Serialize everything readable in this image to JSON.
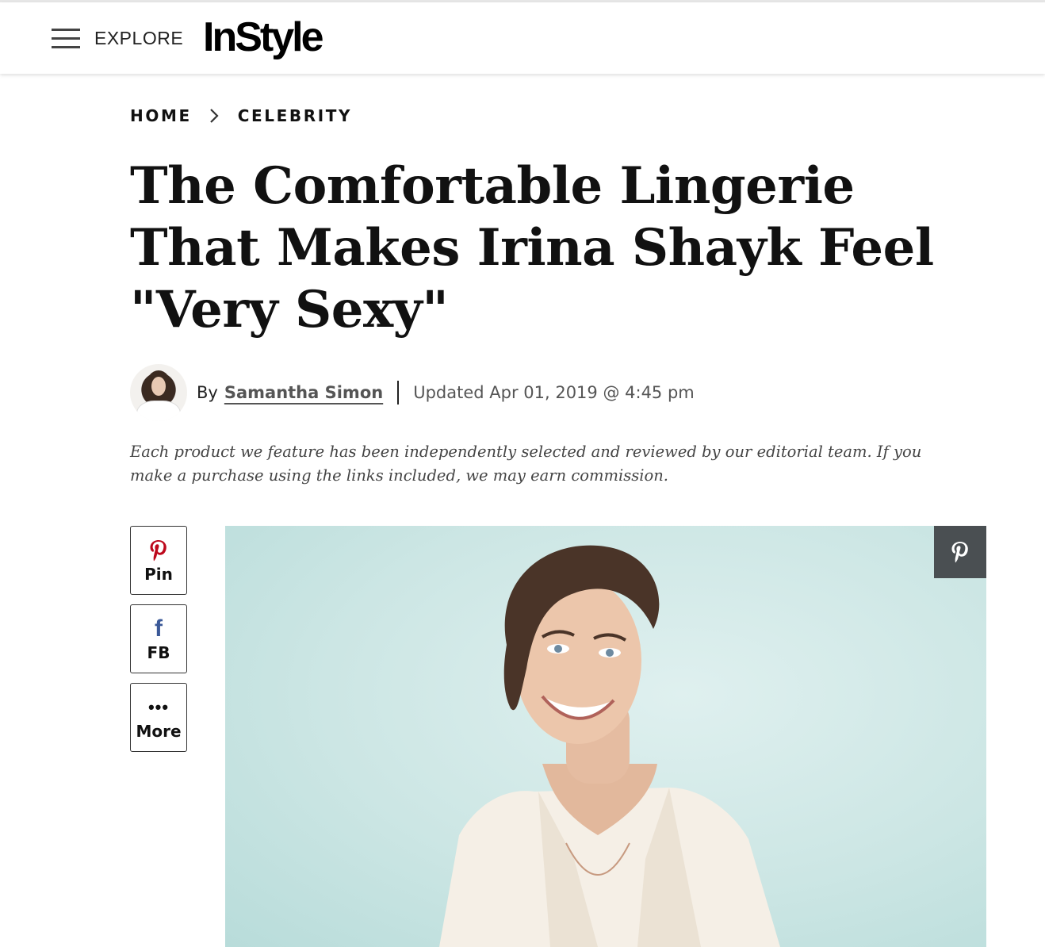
{
  "header": {
    "explore_label": "EXPLORE",
    "logo_text": "InStyle"
  },
  "breadcrumb": {
    "items": [
      "HOME",
      "CELEBRITY"
    ]
  },
  "article": {
    "headline": "The Comfortable Lingerie That Makes Irina Shayk Feel \"Very Sexy\"",
    "by_prefix": "By",
    "author": "Samantha Simon",
    "updated": "Updated Apr 01, 2019 @ 4:45 pm",
    "disclaimer": "Each product we feature has been independently selected and reviewed by our editorial team. If you make a purchase using the links included, we may earn commission."
  },
  "share": {
    "pin_label": "Pin",
    "fb_label": "FB",
    "more_label": "More"
  },
  "icons": {
    "menu": "hamburger-icon",
    "chevron": "chevron-right-icon",
    "pinterest": "pinterest-icon",
    "facebook": "facebook-icon",
    "more": "ellipsis-icon"
  },
  "colors": {
    "pinterest_red": "#bd081c",
    "facebook_blue": "#3b5998",
    "hero_pin_bg": "#4a4f52"
  }
}
